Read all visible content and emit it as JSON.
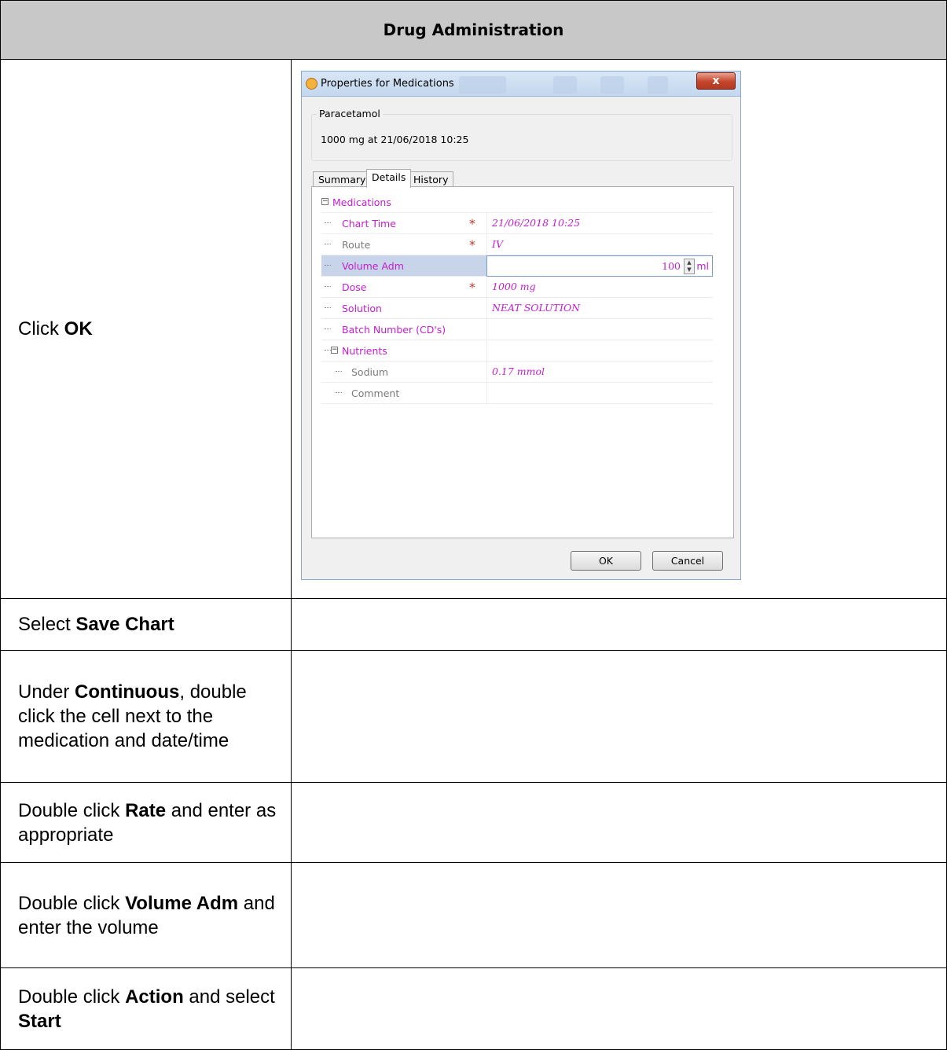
{
  "header": {
    "title": "Drug Administration"
  },
  "steps": [
    {
      "pre": "Click ",
      "bold": "OK",
      "post": ""
    },
    {
      "pre": "Select ",
      "bold": "Save Chart",
      "post": ""
    },
    {
      "pre": "Under ",
      "bold": "Continuous",
      "post": ", double click the cell next to the medication and date/time"
    },
    {
      "pre": "Double click ",
      "bold": "Rate",
      "post": " and enter as appropriate"
    },
    {
      "pre": "Double click ",
      "bold": "Volume Adm",
      "post": " and enter the volume"
    },
    {
      "pre": "Double click ",
      "bold": "Action",
      "post": " and select ",
      "bold2": "Start"
    }
  ],
  "dialog": {
    "title": "Properties for Medications",
    "close_label": "x",
    "drug_name": "Paracetamol",
    "drug_detail": "1000 mg at 21/06/2018 10:25",
    "tabs": [
      "Summary",
      "Details",
      "History"
    ],
    "active_tab": "Details",
    "tree": {
      "group": "Medications",
      "rows": [
        {
          "label": "Chart Time",
          "value": "21/06/2018 10:25",
          "required": true
        },
        {
          "label": "Route",
          "value": "IV",
          "required": true
        },
        {
          "label": "Volume Adm",
          "value": "100",
          "unit": "ml",
          "selected": true
        },
        {
          "label": "Dose",
          "value": "1000 mg",
          "required": true
        },
        {
          "label": "Solution",
          "value": "NEAT SOLUTION"
        },
        {
          "label": "Batch Number (CD's)",
          "value": ""
        }
      ],
      "subgroup": "Nutrients",
      "subrows": [
        {
          "label": "Sodium",
          "value": "0.17 mmol"
        },
        {
          "label": "Comment",
          "value": ""
        }
      ]
    },
    "ok_label": "OK",
    "cancel_label": "Cancel"
  }
}
